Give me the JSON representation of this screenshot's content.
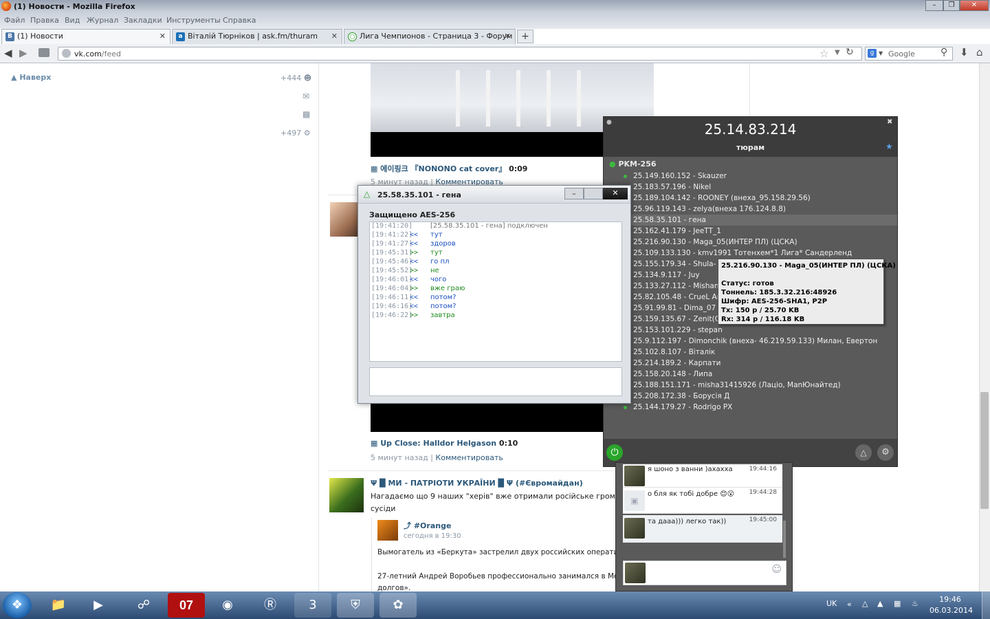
{
  "window": {
    "title": "(1) Новости - Mozilla Firefox"
  },
  "menu": [
    "Файл",
    "Правка",
    "Вид",
    "Журнал",
    "Закладки",
    "Инструменты",
    "Справка"
  ],
  "tabs": [
    {
      "label": "(1) Новости",
      "icon": "В"
    },
    {
      "label": "Віталій Тюрніков | ask.fm/thuram",
      "icon": "a"
    },
    {
      "label": "Лига Чемпионов - Страница 3 - Форум",
      "icon": "○"
    }
  ],
  "nav": {
    "url_host": "vk.com",
    "url_path": "/feed",
    "search_placeholder": "Google"
  },
  "sidebar": {
    "back_to_top": "Наверх",
    "friends_count": "+444",
    "notifications_count": "+497"
  },
  "feed": {
    "video1": {
      "title": "에이핑크 『NONONO cat cover』",
      "duration": "0:09",
      "meta": "5 минут назад",
      "comment": "Комментировать"
    },
    "video2": {
      "title": "Up Close: Halldor Helgason",
      "duration": "0:10",
      "meta": "5 минут назад",
      "comment": "Комментировать"
    },
    "post": {
      "group": "Ψ █ МИ - ПАТРІОТИ УКРАЇНИ █ Ψ (#Євромайдан)",
      "text1": "Нагадаємо що 9 наших \"херів\" вже отримали російське громадянство.",
      "text2": "сусіди",
      "repost_author": "#Orange",
      "repost_time": "сегодня в 19:30",
      "repost_text1": "Вымогатель из «Беркута» застрелил двух российских оперативнико",
      "repost_text2": "27-летний Андрей Воробьев профессионально занимался в Москве де",
      "repost_text3": "долгов»."
    }
  },
  "chat": {
    "title": "25.58.35.101 - гена",
    "security": "Защищено AES-256",
    "messages": [
      {
        "time": "[19:41:20]",
        "dir": "",
        "text": "[25.58.35.101 - гена] подключен",
        "kind": "sys"
      },
      {
        "time": "[19:41:22]",
        "dir": "<<",
        "text": "тут",
        "kind": "in"
      },
      {
        "time": "[19:41:27]",
        "dir": "<<",
        "text": "здоров",
        "kind": "in"
      },
      {
        "time": "[19:45:31]",
        "dir": ">>",
        "text": "тут",
        "kind": "out"
      },
      {
        "time": "[19:45:46]",
        "dir": "<<",
        "text": "го пл",
        "kind": "in"
      },
      {
        "time": "[19:45:52]",
        "dir": ">>",
        "text": "не",
        "kind": "out"
      },
      {
        "time": "[19:46:01]",
        "dir": "<<",
        "text": "чого",
        "kind": "in"
      },
      {
        "time": "[19:46:04]",
        "dir": ">>",
        "text": "вже граю",
        "kind": "out"
      },
      {
        "time": "[19:46:11]",
        "dir": "<<",
        "text": "потом?",
        "kind": "in"
      },
      {
        "time": "[19:46:16]",
        "dir": "<<",
        "text": "потом?",
        "kind": "in"
      },
      {
        "time": "[19:46:22]",
        "dir": ">>",
        "text": "завтра",
        "kind": "out"
      }
    ]
  },
  "vpn": {
    "ip": "25.14.83.214",
    "name": "тюрам",
    "network": "PKM-256",
    "peers": [
      "25.149.160.152 - Skauzer",
      "25.183.57.196 - Nikel",
      "25.189.104.142 - ROONEY (внеха_95.158.29.56)",
      "25.96.119.143 - zelya(внеха 176.124.8.8)",
      "25.58.35.101 - гена",
      "25.162.41.179 - JeeTT_1",
      "25.216.90.130 - Maga_05(ИНТЕР ПЛ) (ЦСКА)",
      "25.109.133.130 - kmv1991 Тотенхем*1 Лига* Сандерленд",
      "25.155.179.34 - Shula- Fi",
      "25.134.9.117 - Juy",
      "25.133.27.112 - Mishanka",
      "25.82.105.48 - CrueL Ars",
      "25.91.99.81 - Dima_07",
      "25.159.135.67 - Zenit(CP",
      "25.153.101.229 - stepan",
      "25.9.112.197 - Dimonchik (внеха- 46.219.59.133) Милан, Евертон",
      "25.102.8.107 - Віталік",
      "25.214.189.2 - Карпати",
      "25.158.20.148 - Липа",
      "25.188.151.171 - misha31415926 (Лацio, ManЮнайтед)",
      "25.208.172.38 - Борусія Д",
      "25.144.179.27 - Rodrigo PX"
    ],
    "selected_index": 4,
    "tooltip": {
      "title": "25.216.90.130 - Maga_05(ИНТЕР ПЛ) (ЦСКА)",
      "status": "Статус: готов",
      "tunnel": "Тоннель: 185.3.32.216:48926",
      "cipher": "Шифр: AES-256-SHA1, P2P",
      "tx": "Tx: 150 p / 25.70 KB",
      "rx": "Rx: 314 p / 116.18 KB"
    }
  },
  "mini_chat": {
    "messages": [
      {
        "text": "я шоно з ванни )ахахха",
        "time": "19:44:16"
      },
      {
        "text": "о бля як тобі добре 😊😮",
        "time": "19:44:28"
      },
      {
        "text": "та дааа))) легко так))",
        "time": "19:45:00"
      }
    ]
  },
  "taskbar": {
    "lang": "UK",
    "time": "19:46",
    "date": "06.03.2014",
    "app7": "07"
  },
  "colors": {
    "vk_link": "#2b587a",
    "chat_in": "#1b4fbf",
    "chat_out": "#1f8a1f",
    "vpn_bg": "#4e4e4e",
    "online": "#3fb93f"
  }
}
